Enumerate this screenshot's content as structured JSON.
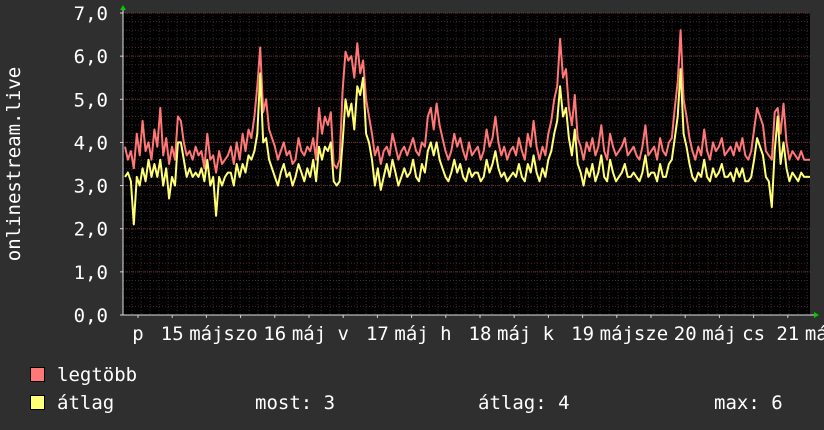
{
  "chart_data": {
    "type": "line",
    "ylabel": "onlinestream.live",
    "ylim": [
      0,
      7
    ],
    "yticks": [
      "0,0",
      "1,0",
      "2,0",
      "3,0",
      "4,0",
      "5,0",
      "6,0",
      "7,0"
    ],
    "x_tick_labels": [
      "p",
      "15",
      "máj",
      "szo",
      "16",
      "máj",
      "v",
      "17",
      "máj",
      "h",
      "18",
      "máj",
      "k",
      "19",
      "máj",
      "sze",
      "20",
      "máj",
      "cs",
      "21",
      "máj"
    ],
    "grid": true,
    "legend_position": "bottom-left",
    "series": [
      {
        "name": "legtöbb",
        "color": "#ff7777",
        "values": [
          3.9,
          3.6,
          3.8,
          3.4,
          4.2,
          3.7,
          4.5,
          3.8,
          4.0,
          3.6,
          4.3,
          3.9,
          4.8,
          3.7,
          4.1,
          3.5,
          3.9,
          3.6,
          4.6,
          4.5,
          4.0,
          3.7,
          3.8,
          3.6,
          3.9,
          3.7,
          3.8,
          3.4,
          4.2,
          3.6,
          3.7,
          3.3,
          3.8,
          3.5,
          3.6,
          3.7,
          3.9,
          3.5,
          4.0,
          3.6,
          4.2,
          3.8,
          4.3,
          4.1,
          4.6,
          5.3,
          6.2,
          4.7,
          5.0,
          4.3,
          4.1,
          3.9,
          3.6,
          3.8,
          4.0,
          3.7,
          3.8,
          3.5,
          3.6,
          4.1,
          3.8,
          3.7,
          3.9,
          3.8,
          4.1,
          3.6,
          4.8,
          4.2,
          4.6,
          4.4,
          4.7,
          3.5,
          3.4,
          3.6,
          5.2,
          6.1,
          5.9,
          6.0,
          5.5,
          6.3,
          5.6,
          5.9,
          5.0,
          4.6,
          4.2,
          3.7,
          3.9,
          3.5,
          3.8,
          3.9,
          3.7,
          4.2,
          3.9,
          3.6,
          3.8,
          3.9,
          3.7,
          3.9,
          4.1,
          3.8,
          3.7,
          4.0,
          3.9,
          4.6,
          4.8,
          4.3,
          4.9,
          4.4,
          4.1,
          3.8,
          3.6,
          3.8,
          4.2,
          3.9,
          4.1,
          3.8,
          3.6,
          4.0,
          3.7,
          3.8,
          3.9,
          3.6,
          3.8,
          4.3,
          3.9,
          4.1,
          4.6,
          4.0,
          3.7,
          3.9,
          3.6,
          3.8,
          3.9,
          3.7,
          4.1,
          3.8,
          3.6,
          4.2,
          3.9,
          4.5,
          3.9,
          3.6,
          3.9,
          3.7,
          4.2,
          4.5,
          5.0,
          5.3,
          6.4,
          5.5,
          5.7,
          4.8,
          4.4,
          5.1,
          4.1,
          3.9,
          3.6,
          4.0,
          3.8,
          4.1,
          3.7,
          3.9,
          4.4,
          3.8,
          3.6,
          4.2,
          3.9,
          3.7,
          3.8,
          3.9,
          4.1,
          3.7,
          3.8,
          3.9,
          3.7,
          3.6,
          3.9,
          4.4,
          3.7,
          3.8,
          3.9,
          3.6,
          4.1,
          3.8,
          3.7,
          4.0,
          4.1,
          4.8,
          5.4,
          6.6,
          5.0,
          4.6,
          4.1,
          3.8,
          3.6,
          3.9,
          3.7,
          4.3,
          3.8,
          3.6,
          4.0,
          3.8,
          3.9,
          4.1,
          3.7,
          3.8,
          3.9,
          3.7,
          4.0,
          3.8,
          4.1,
          3.7,
          3.6,
          3.8,
          4.3,
          4.8,
          4.6,
          4.4,
          3.8,
          3.7,
          3.6,
          4.7,
          4.8,
          4.2,
          4.9,
          4.0,
          3.6,
          3.8,
          3.7,
          3.6,
          3.8,
          3.6,
          3.6,
          3.6
        ]
      },
      {
        "name": "átlag",
        "color": "#ffff77",
        "values": [
          3.2,
          3.3,
          3.1,
          2.1,
          3.2,
          3.0,
          3.4,
          3.1,
          3.6,
          3.2,
          3.5,
          3.2,
          3.6,
          3.0,
          3.4,
          2.7,
          3.2,
          3.0,
          4.0,
          4.0,
          3.6,
          3.2,
          3.4,
          3.2,
          3.3,
          3.2,
          3.4,
          3.1,
          3.6,
          3.0,
          3.2,
          2.3,
          3.2,
          3.0,
          3.2,
          3.3,
          3.3,
          3.0,
          3.5,
          3.2,
          3.5,
          3.3,
          3.7,
          3.6,
          3.8,
          4.2,
          5.6,
          4.0,
          4.1,
          3.6,
          3.4,
          3.2,
          3.0,
          3.3,
          3.5,
          3.2,
          3.3,
          3.0,
          3.2,
          3.5,
          3.3,
          3.1,
          3.4,
          3.2,
          3.6,
          3.1,
          3.9,
          3.6,
          3.9,
          3.8,
          4.0,
          3.1,
          3.0,
          3.1,
          4.0,
          5.0,
          4.6,
          4.9,
          4.3,
          5.3,
          5.1,
          5.5,
          4.2,
          4.0,
          3.6,
          3.0,
          3.4,
          2.9,
          3.2,
          3.5,
          3.2,
          3.6,
          3.3,
          3.0,
          3.2,
          3.4,
          3.2,
          3.3,
          3.6,
          3.2,
          3.1,
          3.5,
          3.3,
          3.8,
          4.0,
          3.7,
          4.0,
          3.6,
          3.4,
          3.2,
          3.1,
          3.3,
          3.6,
          3.3,
          3.5,
          3.2,
          3.1,
          3.4,
          3.2,
          3.3,
          3.3,
          3.1,
          3.2,
          3.6,
          3.3,
          3.5,
          3.8,
          3.4,
          3.2,
          3.3,
          3.1,
          3.2,
          3.3,
          3.2,
          3.5,
          3.2,
          3.1,
          3.5,
          3.3,
          3.7,
          3.3,
          3.1,
          3.4,
          3.2,
          3.6,
          3.8,
          4.2,
          4.5,
          5.3,
          4.6,
          4.8,
          4.1,
          3.7,
          4.3,
          3.5,
          3.3,
          3.0,
          3.4,
          3.2,
          3.5,
          3.1,
          3.3,
          3.7,
          3.2,
          3.1,
          3.6,
          3.3,
          3.1,
          3.2,
          3.3,
          3.5,
          3.2,
          3.2,
          3.3,
          3.2,
          3.1,
          3.3,
          3.7,
          3.2,
          3.3,
          3.3,
          3.1,
          3.5,
          3.2,
          3.2,
          3.5,
          3.6,
          4.1,
          4.6,
          5.7,
          4.2,
          3.9,
          3.5,
          3.2,
          3.1,
          3.3,
          3.2,
          3.6,
          3.2,
          3.1,
          3.4,
          3.2,
          3.3,
          3.5,
          3.2,
          3.2,
          3.3,
          3.1,
          3.4,
          3.2,
          3.4,
          3.1,
          3.1,
          3.2,
          3.6,
          4.1,
          3.9,
          3.7,
          3.2,
          3.1,
          2.5,
          3.8,
          4.6,
          3.5,
          4.0,
          3.4,
          3.1,
          3.3,
          3.2,
          3.1,
          3.3,
          3.2,
          3.2,
          3.2
        ]
      }
    ],
    "stats": {
      "most": "most: 3",
      "avg": "átlag: 4",
      "max": "max: 6"
    }
  }
}
